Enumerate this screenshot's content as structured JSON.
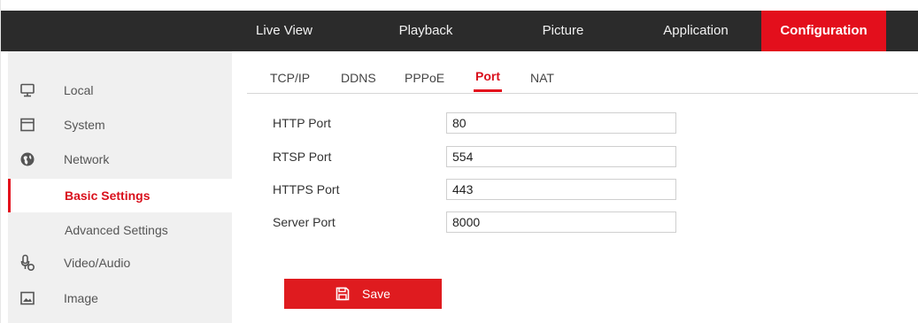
{
  "topnav": {
    "items": [
      {
        "label": "Live View"
      },
      {
        "label": "Playback"
      },
      {
        "label": "Picture"
      },
      {
        "label": "Application"
      },
      {
        "label": "Configuration"
      }
    ],
    "active_index": 4
  },
  "sidebar": {
    "items": [
      {
        "label": "Local",
        "icon": "monitor-icon"
      },
      {
        "label": "System",
        "icon": "system-icon"
      },
      {
        "label": "Network",
        "icon": "globe-icon"
      },
      {
        "label": "Basic Settings",
        "icon": ""
      },
      {
        "label": "Advanced Settings",
        "icon": ""
      },
      {
        "label": "Video/Audio",
        "icon": "microphone-icon"
      },
      {
        "label": "Image",
        "icon": "image-icon"
      }
    ],
    "selected": "Basic Settings"
  },
  "tabs": {
    "items": [
      {
        "label": "TCP/IP"
      },
      {
        "label": "DDNS"
      },
      {
        "label": "PPPoE"
      },
      {
        "label": "Port"
      },
      {
        "label": "NAT"
      }
    ],
    "active": "Port"
  },
  "form": {
    "fields": [
      {
        "label": "HTTP Port",
        "value": "80"
      },
      {
        "label": "RTSP Port",
        "value": "554"
      },
      {
        "label": "HTTPS Port",
        "value": "443"
      },
      {
        "label": "Server Port",
        "value": "8000"
      }
    ],
    "save_label": "Save"
  },
  "colors": {
    "accent": "#e30f1c",
    "topbar": "#2b2b2b",
    "sidebar": "#f0f0f0"
  }
}
